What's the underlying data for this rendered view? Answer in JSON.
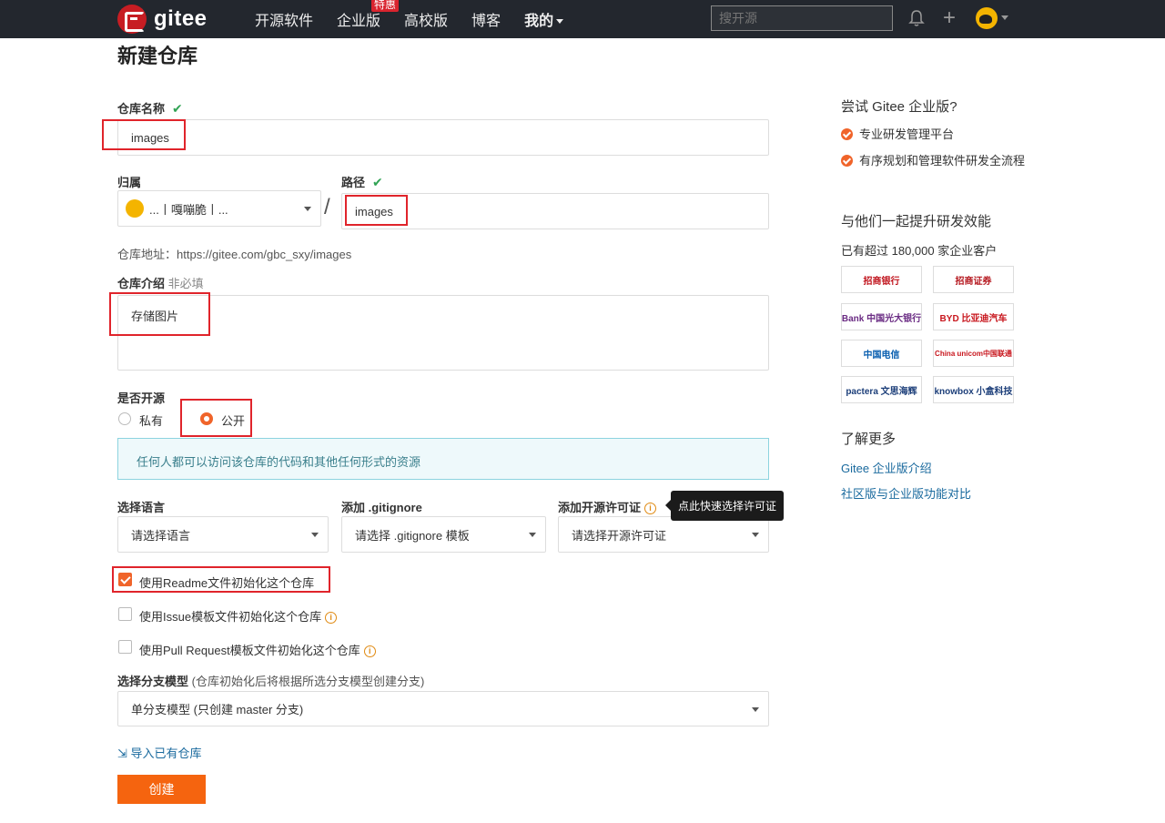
{
  "header": {
    "logo_text": "gitee",
    "nav": [
      {
        "label": "开源软件"
      },
      {
        "label": "企业版",
        "badge": "特惠"
      },
      {
        "label": "高校版"
      },
      {
        "label": "博客"
      },
      {
        "label": "我的"
      }
    ],
    "search_placeholder": "搜开源"
  },
  "page_title": "新建仓库",
  "form": {
    "repo_name_label": "仓库名称",
    "repo_name_value": "images",
    "owner_label": "归属",
    "owner_value": "...丨嘎嘣脆丨...",
    "path_label": "路径",
    "path_value": "images",
    "repo_url_label": "仓库地址：",
    "repo_url_value": "https://gitee.com/gbc_sxy/images",
    "desc_label": "仓库介绍",
    "desc_optional": "非必填",
    "desc_value": "存储图片",
    "open_source_label": "是否开源",
    "private_label": "私有",
    "public_label": "公开",
    "public_info": "任何人都可以访问该仓库的代码和其他任何形式的资源",
    "language_label": "选择语言",
    "language_value": "请选择语言",
    "gitignore_label": "添加 .gitignore",
    "gitignore_value": "请选择 .gitignore 模板",
    "license_label": "添加开源许可证",
    "license_value": "请选择开源许可证",
    "license_tooltip": "点此快速选择许可证",
    "readme_label": "使用Readme文件初始化这个仓库",
    "issue_label": "使用Issue模板文件初始化这个仓库",
    "pr_label": "使用Pull Request模板文件初始化这个仓库",
    "branch_label": "选择分支模型",
    "branch_hint": "(仓库初始化后将根据所选分支模型创建分支)",
    "branch_value": "单分支模型 (只创建 master 分支)",
    "import_label": "导入已有仓库",
    "create_label": "创建"
  },
  "sidebar": {
    "try_title": "尝试 Gitee 企业版?",
    "try_items": [
      "专业研发管理平台",
      "有序规划和管理软件研发全流程"
    ],
    "together_title": "与他们一起提升研发效能",
    "customers_text": "已有超过 180,000 家企业客户",
    "logos": [
      "招商银行",
      "招商证券",
      "Bank 中国光大银行",
      "BYD 比亚迪汽车",
      "中国电信",
      "China unicom中国联通",
      "pactera 文思海辉",
      "knowbox 小盒科技"
    ],
    "learn_title": "了解更多",
    "links": [
      "Gitee 企业版介绍",
      "社区版与企业版功能对比"
    ]
  },
  "colors": {
    "accent": "#f5640f",
    "header_bg": "#23272e",
    "highlight_box": "#e0242b",
    "link": "#1a6a9e"
  }
}
